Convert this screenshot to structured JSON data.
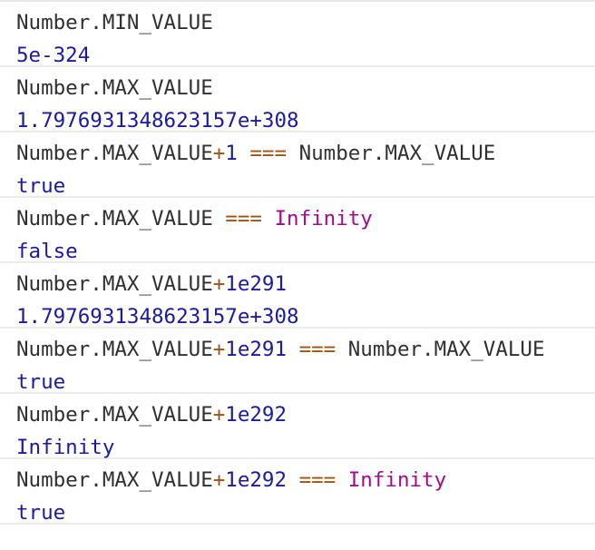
{
  "entries": [
    {
      "input": [
        {
          "text": "Number.MIN_VALUE",
          "kind": "ident"
        }
      ],
      "result": "5e-324"
    },
    {
      "input": [
        {
          "text": "Number.MAX_VALUE",
          "kind": "ident"
        }
      ],
      "result": "1.7976931348623157e+308"
    },
    {
      "input": [
        {
          "text": "Number.MAX_VALUE",
          "kind": "ident"
        },
        {
          "text": "+",
          "kind": "op"
        },
        {
          "text": "1",
          "kind": "num"
        },
        {
          "text": " ",
          "kind": "ident"
        },
        {
          "text": "===",
          "kind": "op"
        },
        {
          "text": " Number.MAX_VALUE",
          "kind": "ident"
        }
      ],
      "result": "true"
    },
    {
      "input": [
        {
          "text": "Number.MAX_VALUE ",
          "kind": "ident"
        },
        {
          "text": "===",
          "kind": "op"
        },
        {
          "text": " ",
          "kind": "ident"
        },
        {
          "text": "Infinity",
          "kind": "const"
        }
      ],
      "result": "false"
    },
    {
      "input": [
        {
          "text": "Number.MAX_VALUE",
          "kind": "ident"
        },
        {
          "text": "+",
          "kind": "op"
        },
        {
          "text": "1e291",
          "kind": "num"
        }
      ],
      "result": "1.7976931348623157e+308"
    },
    {
      "input": [
        {
          "text": "Number.MAX_VALUE",
          "kind": "ident"
        },
        {
          "text": "+",
          "kind": "op"
        },
        {
          "text": "1e291",
          "kind": "num"
        },
        {
          "text": " ",
          "kind": "ident"
        },
        {
          "text": "===",
          "kind": "op"
        },
        {
          "text": " Number.MAX_VALUE",
          "kind": "ident"
        }
      ],
      "result": "true"
    },
    {
      "input": [
        {
          "text": "Number.MAX_VALUE",
          "kind": "ident"
        },
        {
          "text": "+",
          "kind": "op"
        },
        {
          "text": "1e292",
          "kind": "num"
        }
      ],
      "result": "Infinity"
    },
    {
      "input": [
        {
          "text": "Number.MAX_VALUE",
          "kind": "ident"
        },
        {
          "text": "+",
          "kind": "op"
        },
        {
          "text": "1e292",
          "kind": "num"
        },
        {
          "text": " ",
          "kind": "ident"
        },
        {
          "text": "===",
          "kind": "op"
        },
        {
          "text": " ",
          "kind": "ident"
        },
        {
          "text": "Infinity",
          "kind": "const"
        }
      ],
      "result": "true"
    }
  ],
  "colors": {
    "identifier": "#303030",
    "number": "#1a1aa6",
    "operator": "#a0520f",
    "constant": "#a30a92",
    "result": "#1a1aa6",
    "separator": "#ececec"
  }
}
